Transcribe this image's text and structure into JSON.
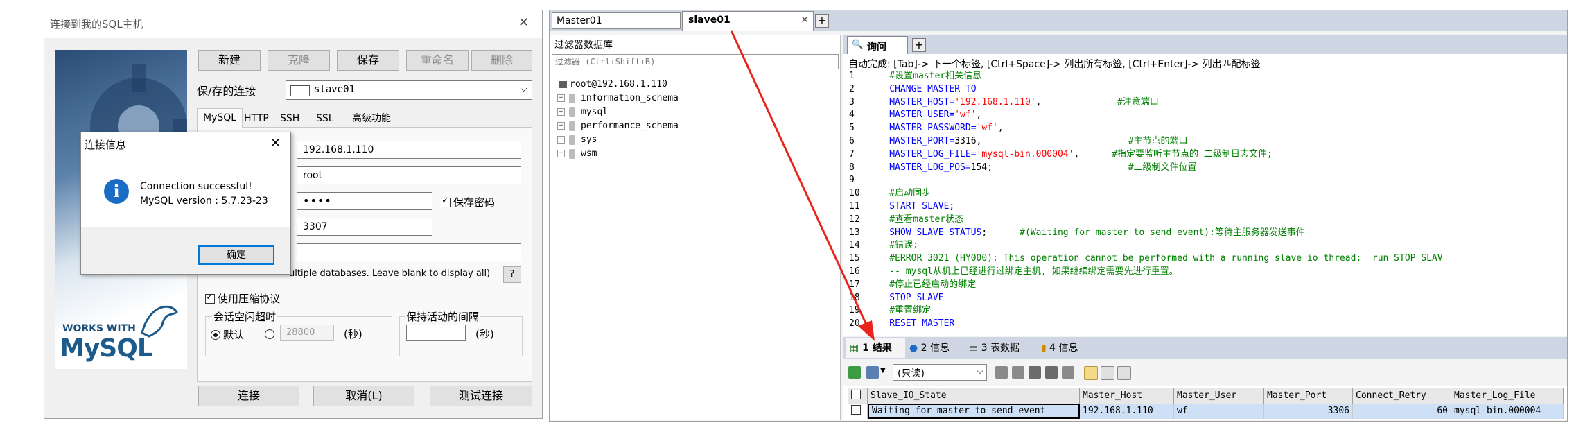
{
  "dialog": {
    "title": "连接到我的SQL主机",
    "close": "✕",
    "toolbar": {
      "new": "新建",
      "clone": "克隆",
      "save": "保存",
      "rename": "重命名",
      "delete": "删除"
    },
    "saved_label": "保/存的连接",
    "saved_value": "slave01",
    "tabs": [
      "MySQL",
      "HTTP",
      "SSH",
      "SSL",
      "高级功能"
    ],
    "host": "192.168.1.110",
    "user": "root",
    "password": "••••",
    "save_password": "保存密码",
    "port": "3307",
    "database": "",
    "db_hint": "ultiple databases. Leave blank to display all)",
    "help": "?",
    "compress": "使用压缩协议",
    "session_group": "会话空闲超时",
    "default_label": "默认",
    "timeout_value": "28800",
    "seconds": "(秒)",
    "keepalive_group": "保持活动的间隔",
    "keepalive_seconds": "(秒)",
    "connect": "连接",
    "cancel": "取消(L)",
    "test": "测试连接",
    "logo_works": "WORKS WITH",
    "logo_mysql": "MySQL"
  },
  "msgbox": {
    "title": "连接信息",
    "close": "✕",
    "line1": "Connection successful!",
    "line2": "MySQL version : 5.7.23-23",
    "ok": "确定",
    "icon": "info-icon"
  },
  "workbench": {
    "tabs": [
      {
        "label": "Master01"
      },
      {
        "label": "slave01"
      }
    ],
    "tab_close": "✕",
    "tab_add": "+",
    "filter_title": "过滤器数据库",
    "filter_placeholder": "过滤器 (Ctrl+Shift+B)",
    "tree": {
      "root": "root@192.168.1.110",
      "items": [
        "information_schema",
        "mysql",
        "performance_schema",
        "sys",
        "wsm"
      ]
    },
    "query_tab": "询问",
    "query_add": "+",
    "hint": "自动完成: [Tab]-> 下一个标签, [Ctrl+Space]-> 列出所有标签, [Ctrl+Enter]-> 列出匹配标签",
    "code": [
      {
        "n": "1",
        "parts": [
          {
            "c": "cm",
            "t": "    #设置master相关信息"
          }
        ]
      },
      {
        "n": "2",
        "parts": [
          {
            "c": "kw",
            "t": "    CHANGE MASTER TO"
          }
        ]
      },
      {
        "n": "3",
        "parts": [
          {
            "c": "kw",
            "t": "    MASTER_HOST="
          },
          {
            "c": "st",
            "t": "'192.168.1.110'"
          },
          {
            "c": "pl",
            "t": ",              "
          },
          {
            "c": "cm",
            "t": "#注意端口"
          }
        ]
      },
      {
        "n": "4",
        "parts": [
          {
            "c": "kw",
            "t": "    MASTER_USER="
          },
          {
            "c": "st",
            "t": "'wf'"
          },
          {
            "c": "pl",
            "t": ","
          }
        ]
      },
      {
        "n": "5",
        "parts": [
          {
            "c": "kw",
            "t": "    MASTER_PASSWORD="
          },
          {
            "c": "st",
            "t": "'wf'"
          },
          {
            "c": "pl",
            "t": ","
          }
        ]
      },
      {
        "n": "6",
        "parts": [
          {
            "c": "kw",
            "t": "    MASTER_PORT="
          },
          {
            "c": "pl",
            "t": "3316,                           "
          },
          {
            "c": "cm",
            "t": "#主节点的端口"
          }
        ]
      },
      {
        "n": "7",
        "parts": [
          {
            "c": "kw",
            "t": "    MASTER_LOG_FILE="
          },
          {
            "c": "st",
            "t": "'mysql-bin.000004'"
          },
          {
            "c": "pl",
            "t": ",      "
          },
          {
            "c": "cm",
            "t": "#指定要监听主节点的 二级制日志文件;"
          }
        ]
      },
      {
        "n": "8",
        "parts": [
          {
            "c": "kw",
            "t": "    MASTER_LOG_POS="
          },
          {
            "c": "pl",
            "t": "154;                         "
          },
          {
            "c": "cm",
            "t": "#二级制文件位置"
          }
        ]
      },
      {
        "n": "9",
        "parts": [
          {
            "c": "pl",
            "t": ""
          }
        ]
      },
      {
        "n": "10",
        "parts": [
          {
            "c": "cm",
            "t": "    #启动同步"
          }
        ]
      },
      {
        "n": "11",
        "parts": [
          {
            "c": "kw",
            "t": "    START SLAVE"
          },
          {
            "c": "pl",
            "t": ";"
          }
        ]
      },
      {
        "n": "12",
        "parts": [
          {
            "c": "cm",
            "t": "    #查看master状态"
          }
        ]
      },
      {
        "n": "13",
        "parts": [
          {
            "c": "kw",
            "t": "    SHOW SLAVE STATUS"
          },
          {
            "c": "pl",
            "t": ";      "
          },
          {
            "c": "cm",
            "t": "#(Waiting for master to send event):等待主服务器发送事件"
          }
        ]
      },
      {
        "n": "14",
        "parts": [
          {
            "c": "cm",
            "t": "    #错误:"
          }
        ]
      },
      {
        "n": "15",
        "parts": [
          {
            "c": "cm",
            "t": "    #ERROR 3021 (HY000): This operation cannot be performed with a running slave io thread;  run STOP SLAV"
          }
        ]
      },
      {
        "n": "16",
        "parts": [
          {
            "c": "cm",
            "t": "    -- mysql从机上已经进行过绑定主机, 如果继续绑定需要先进行重置。"
          }
        ]
      },
      {
        "n": "17",
        "parts": [
          {
            "c": "cm",
            "t": "    #停止已经启动的绑定"
          }
        ]
      },
      {
        "n": "18",
        "parts": [
          {
            "c": "kw",
            "t": "    STOP SLAVE"
          }
        ]
      },
      {
        "n": "19",
        "parts": [
          {
            "c": "cm",
            "t": "    #重置绑定"
          }
        ]
      },
      {
        "n": "20",
        "parts": [
          {
            "c": "kw",
            "t": "    RESET MASTER"
          }
        ]
      }
    ],
    "result_tabs": [
      "1 结果",
      "2 信息",
      "3 表数据",
      "4 信息"
    ],
    "readonly": "(只读)",
    "columns": [
      "Slave_IO_State",
      "Master_Host",
      "Master_User",
      "Master_Port",
      "Connect_Retry",
      "Master_Log_File"
    ],
    "row": [
      "Waiting for master to send event",
      "192.168.1.110",
      "wf",
      "3306",
      "60",
      "mysql-bin.000004"
    ]
  },
  "colors": {
    "arrow": "#e8251d",
    "keyword": "#0000ff",
    "comment": "#008000",
    "string": "#ff0000",
    "selection": "#cde0f5"
  }
}
